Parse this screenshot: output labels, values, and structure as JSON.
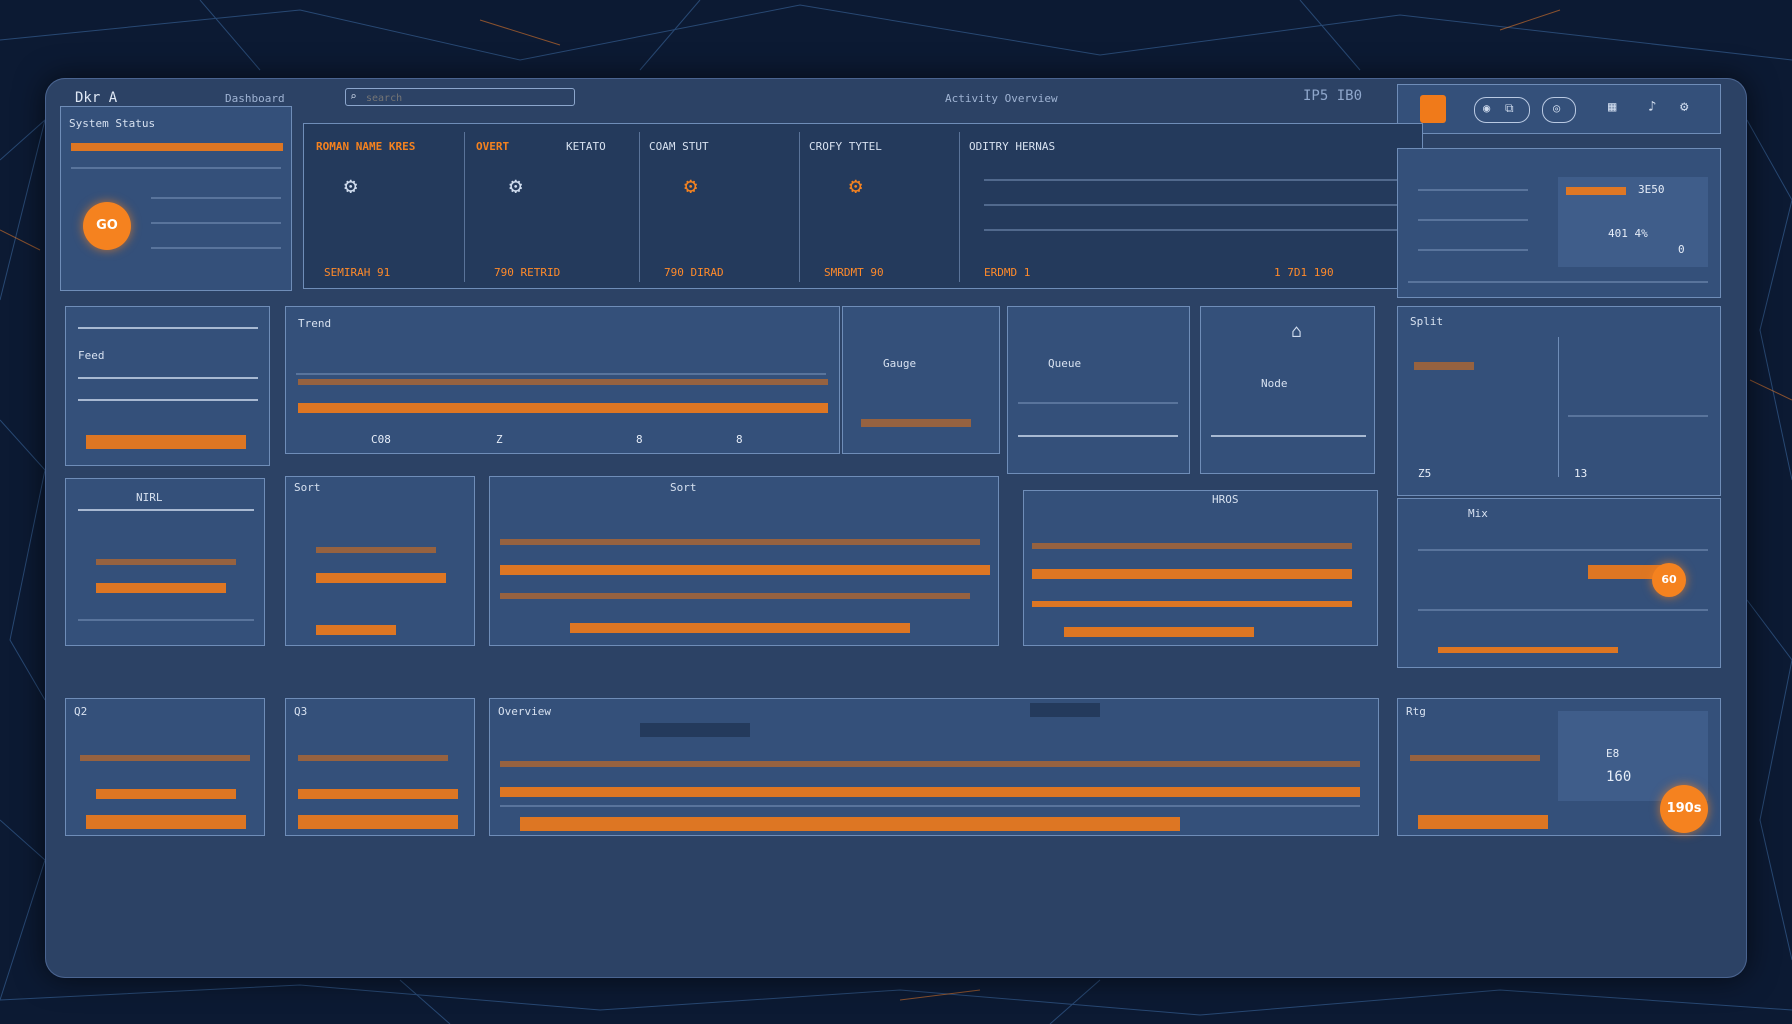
{
  "header": {
    "app_title": "Dkr A",
    "breadcrumb": "Dashboard",
    "search_placeholder": "search",
    "center_label": "Activity Overview",
    "top_right_code": "IP5 IB0"
  },
  "summary_panel": {
    "title": "System Status",
    "action_label": "GO"
  },
  "metrics_strip": {
    "columns": [
      {
        "label": "ROMAN NAME KRES",
        "accent": true
      },
      {
        "label": "OVERT",
        "accent": true
      },
      {
        "label": "KETATO",
        "accent": false
      },
      {
        "label": "COAM STUT",
        "accent": false
      },
      {
        "label": "CROFY TYTEL",
        "accent": false
      },
      {
        "label": "ODITRY HERNAS",
        "accent": false
      }
    ],
    "footer_values": [
      "SEMIRAH 91",
      "790 RETRID",
      "790 DIRAD",
      "SMRDMT 90",
      "ERDMD 1",
      "1 7D1 190"
    ]
  },
  "right_top_panel": {
    "value_a": "3E50",
    "value_b": "401 4%",
    "value_c": "0"
  },
  "middle_row": {
    "panel_labels": [
      "Feed",
      "Trend",
      "Gauge",
      "Queue",
      "Node",
      "Split"
    ],
    "axis_labels": [
      "C08",
      "Z",
      "8",
      "8"
    ],
    "right_values": [
      "Z5",
      "13"
    ]
  },
  "lower_row": {
    "titles": [
      "NIRL",
      "Sort",
      "Sort",
      "HROS",
      "Mix"
    ],
    "fab_label": "60"
  },
  "bottom_row": {
    "titles": [
      "Q2",
      "Q3",
      "Overview",
      "Rtg"
    ],
    "right_values": [
      "E8",
      "160"
    ],
    "fab_label": "190s"
  },
  "colors": {
    "accent": "#f5821f",
    "panel": "#34507a",
    "background": "#0c1a33"
  }
}
